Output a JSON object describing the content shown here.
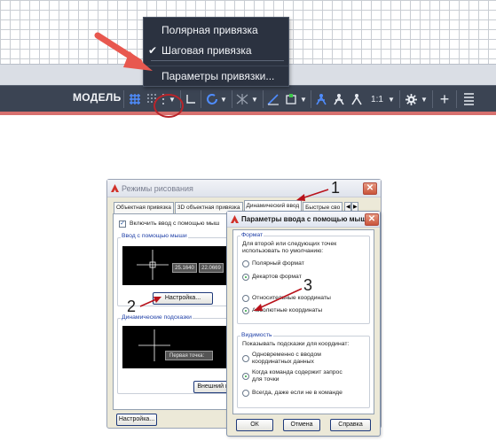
{
  "toolbar": {
    "model_label": "МОДЕЛЬ",
    "scale_label": "1:1"
  },
  "dropdown": {
    "items": [
      {
        "label": "Полярная привязка",
        "checked": false
      },
      {
        "label": "Шаговая привязка",
        "checked": true
      },
      {
        "label": "Параметры привязки...",
        "checked": false
      }
    ]
  },
  "dialog_main": {
    "title": "Режимы рисования",
    "tabs": [
      "Объектная привязка",
      "3D объектная привязка",
      "Динамический ввод",
      "Быстрые сво"
    ],
    "active_tab": "Динамический ввод",
    "enable_pointer_input": "Включить ввод с помощью мыш",
    "pointer_group": "Ввод с помощью мыши",
    "coord_x": "25.1640",
    "coord_y": "22.0669",
    "settings_button": "Настройка...",
    "dynamic_group": "Динамические подсказки",
    "first_point": "Первая точка:",
    "appearance_button": "Внешний ви",
    "bottom_settings_button": "Настройка..."
  },
  "dialog_params": {
    "title": "Параметры ввода с помощью мыш",
    "format_group": "Формат",
    "format_desc_1": "Для второй или следующих точек",
    "format_desc_2": "использовать по умолчанию:",
    "polar": "Полярный формат",
    "cartesian": "Декартов формат",
    "relative": "Относительные координаты",
    "absolute": "Абсолютные координаты",
    "visibility_group": "Видимость",
    "visibility_desc": "Показывать подсказки для координат:",
    "vis_opt1_a": "Одновременно с вводом",
    "vis_opt1_b": "координатных данных",
    "vis_opt2_a": "Когда команда содержит запрос",
    "vis_opt2_b": "для точки",
    "vis_opt3": "Всегда, даже если не в команде",
    "ok": "ОК",
    "cancel": "Отмена",
    "help": "Справка"
  },
  "annotations": {
    "n1": "1",
    "n2": "2",
    "n3": "3"
  },
  "colors": {
    "status_bar": "#3b4453",
    "accent_red": "#b9242a",
    "pink_arrow": "#e8584f",
    "active_blue": "#2f6fe0"
  }
}
